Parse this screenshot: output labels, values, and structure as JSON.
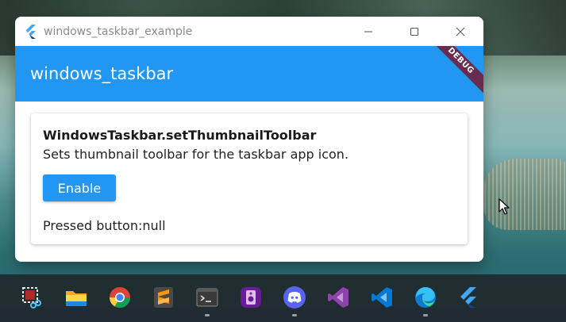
{
  "window": {
    "title": "windows_taskbar_example",
    "controls": [
      "minimize",
      "maximize",
      "close"
    ]
  },
  "appbar": {
    "title": "windows_taskbar",
    "debug_banner": "DEBUG",
    "color": "#2196f3"
  },
  "card": {
    "title": "WindowsTaskbar.setThumbnailToolbar",
    "description": "Sets thumbnail toolbar for the taskbar app icon.",
    "button_label": "Enable",
    "pressed_text": "Pressed button:null"
  },
  "taskbar": {
    "icons": [
      {
        "name": "snipping-tool-icon",
        "running": false
      },
      {
        "name": "file-explorer-icon",
        "running": false
      },
      {
        "name": "chrome-icon",
        "running": false
      },
      {
        "name": "sublime-text-icon",
        "running": false
      },
      {
        "name": "terminal-icon",
        "running": true
      },
      {
        "name": "media-app-icon",
        "running": false
      },
      {
        "name": "discord-icon",
        "running": true
      },
      {
        "name": "visual-studio-icon",
        "running": false
      },
      {
        "name": "vscode-icon",
        "running": false
      },
      {
        "name": "edge-icon",
        "running": true
      },
      {
        "name": "flutter-app-icon",
        "running": false
      }
    ]
  }
}
